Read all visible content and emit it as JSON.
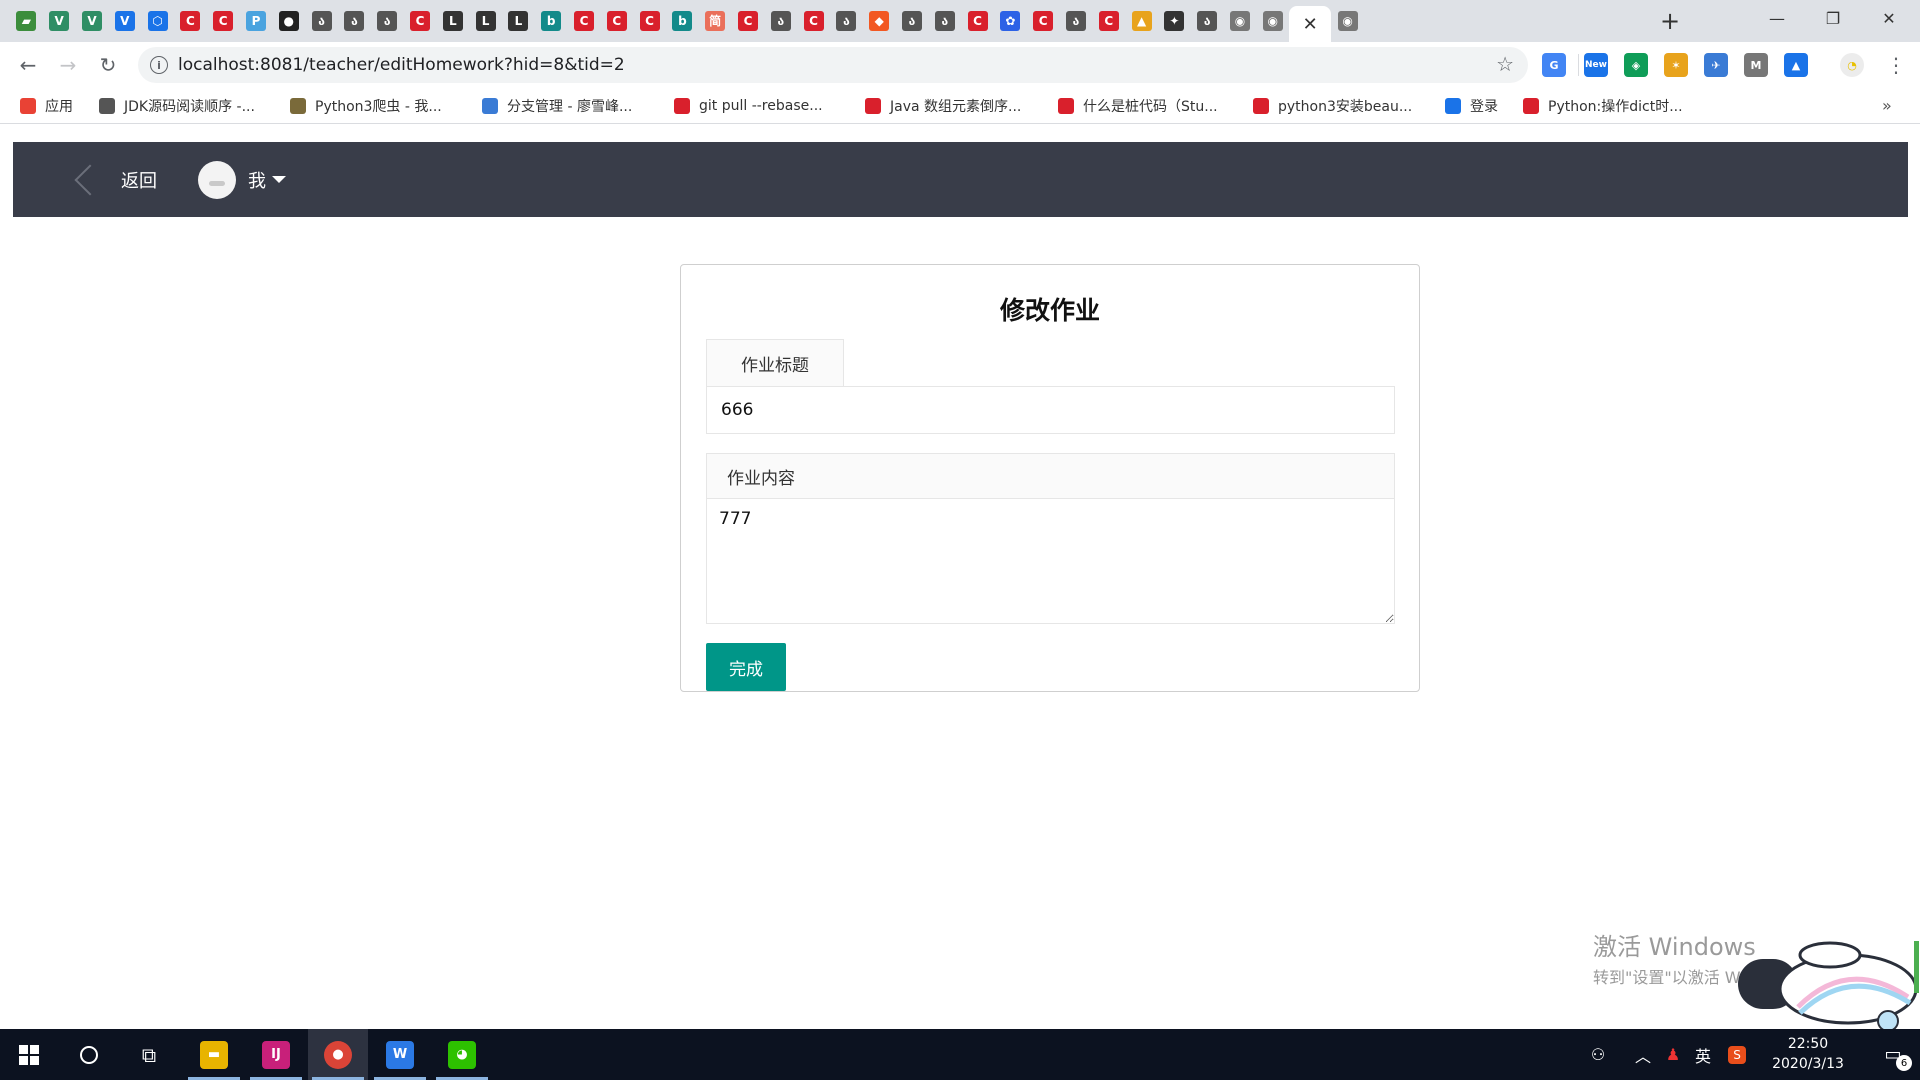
{
  "browser": {
    "tabs": [
      {
        "icon": "map-icon",
        "glyph": "▰",
        "color": "#3c8d3c"
      },
      {
        "icon": "vue-icon",
        "glyph": "V",
        "color": "#2f8e65"
      },
      {
        "icon": "vue-icon",
        "glyph": "V",
        "color": "#2f8e65"
      },
      {
        "icon": "vuetify-icon",
        "glyph": "V",
        "color": "#1a73e8"
      },
      {
        "icon": "hexagon-icon",
        "glyph": "⬡",
        "color": "#1a73e8"
      },
      {
        "icon": "csdn-icon",
        "glyph": "C",
        "color": "#d9202c"
      },
      {
        "icon": "csdn-icon",
        "glyph": "C",
        "color": "#d9202c"
      },
      {
        "icon": "p-circle-icon",
        "glyph": "P",
        "color": "#4aa3df"
      },
      {
        "icon": "github-icon",
        "glyph": "●",
        "color": "#222222"
      },
      {
        "icon": "blog-icon",
        "glyph": "ა",
        "color": "#555555"
      },
      {
        "icon": "blog-icon",
        "glyph": "ა",
        "color": "#555555"
      },
      {
        "icon": "blog-icon",
        "glyph": "ა",
        "color": "#555555"
      },
      {
        "icon": "csdn-icon",
        "glyph": "C",
        "color": "#d9202c"
      },
      {
        "icon": "leetcode-icon",
        "glyph": "L",
        "color": "#333333"
      },
      {
        "icon": "leetcode-icon",
        "glyph": "L",
        "color": "#333333"
      },
      {
        "icon": "leetcode-icon",
        "glyph": "L",
        "color": "#333333"
      },
      {
        "icon": "bing-icon",
        "glyph": "b",
        "color": "#138a8a"
      },
      {
        "icon": "csdn-icon",
        "glyph": "C",
        "color": "#d9202c"
      },
      {
        "icon": "csdn-icon",
        "glyph": "C",
        "color": "#d9202c"
      },
      {
        "icon": "csdn-icon",
        "glyph": "C",
        "color": "#d9202c"
      },
      {
        "icon": "bing-icon",
        "glyph": "b",
        "color": "#138a8a"
      },
      {
        "icon": "jianshu-icon",
        "glyph": "简",
        "color": "#ea6f5a"
      },
      {
        "icon": "csdn-icon",
        "glyph": "C",
        "color": "#d9202c"
      },
      {
        "icon": "blog-icon",
        "glyph": "ა",
        "color": "#555555"
      },
      {
        "icon": "csdn-icon",
        "glyph": "C",
        "color": "#d9202c"
      },
      {
        "icon": "blog-icon",
        "glyph": "ა",
        "color": "#555555"
      },
      {
        "icon": "brave-icon",
        "glyph": "◆",
        "color": "#f25822"
      },
      {
        "icon": "blog-icon",
        "glyph": "ა",
        "color": "#555555"
      },
      {
        "icon": "blog-icon",
        "glyph": "ა",
        "color": "#555555"
      },
      {
        "icon": "csdn-icon",
        "glyph": "C",
        "color": "#d9202c"
      },
      {
        "icon": "baidu-icon",
        "glyph": "✿",
        "color": "#2d62e6"
      },
      {
        "icon": "csdn-icon",
        "glyph": "C",
        "color": "#d9202c"
      },
      {
        "icon": "blog-icon",
        "glyph": "ა",
        "color": "#555555"
      },
      {
        "icon": "csdn-icon",
        "glyph": "C",
        "color": "#d9202c"
      },
      {
        "icon": "pma-icon",
        "glyph": "▲",
        "color": "#e8a31c"
      },
      {
        "icon": "animal-icon",
        "glyph": "✦",
        "color": "#333333"
      },
      {
        "icon": "blog-icon",
        "glyph": "ა",
        "color": "#555555"
      },
      {
        "icon": "globe-icon",
        "glyph": "◉",
        "color": "#777777"
      },
      {
        "icon": "globe-icon",
        "glyph": "◉",
        "color": "#777777"
      },
      {
        "icon": "close-icon",
        "glyph": "✕",
        "color": "#333333",
        "active": true
      },
      {
        "icon": "globe-icon",
        "glyph": "◉",
        "color": "#777777"
      }
    ],
    "url": "localhost:8081/teacher/editHomework?hid=8&tid=2",
    "bookmarks": [
      {
        "icon": "apps-grid-icon",
        "label": "应用",
        "color": "#e94235"
      },
      {
        "icon": "globe-icon",
        "label": "JDK源码阅读顺序 -...",
        "color": "#555555"
      },
      {
        "icon": "python-book-icon",
        "label": "Python3爬虫 - 我...",
        "color": "#7a6a3a"
      },
      {
        "icon": "rocket-icon",
        "label": "分支管理 - 廖雪峰...",
        "color": "#3a7bd5"
      },
      {
        "icon": "csdn-icon",
        "label": "git pull --rebase...",
        "color": "#d9202c"
      },
      {
        "icon": "csdn-icon",
        "label": "Java 数组元素倒序...",
        "color": "#d9202c"
      },
      {
        "icon": "csdn-icon",
        "label": "什么是桩代码（Stu...",
        "color": "#d9202c"
      },
      {
        "icon": "csdn-icon",
        "label": "python3安装beau...",
        "color": "#d9202c"
      },
      {
        "icon": "login-icon",
        "label": "登录",
        "color": "#1a73e8"
      },
      {
        "icon": "csdn-icon",
        "label": "Python:操作dict时...",
        "color": "#d9202c"
      }
    ],
    "extensions": [
      {
        "icon": "translate-icon",
        "glyph": "G",
        "color": "#4285f4"
      },
      {
        "icon": "new-badge-icon",
        "glyph": "New",
        "color": "#1a73e8"
      },
      {
        "icon": "colorful-square-icon",
        "glyph": "◈",
        "color": "#0f9d58"
      },
      {
        "icon": "star-cluster-icon",
        "glyph": "✶",
        "color": "#e8a31c"
      },
      {
        "icon": "bird-icon",
        "glyph": "✈",
        "color": "#3a7bd5"
      },
      {
        "icon": "mail-icon",
        "glyph": "M",
        "color": "#777777"
      },
      {
        "icon": "graduation-icon",
        "glyph": "▲",
        "color": "#1a73e8"
      }
    ]
  },
  "app": {
    "back_label": "返回",
    "user_label": "我",
    "form": {
      "heading": "修改作业",
      "title_label": "作业标题",
      "title_value": "666",
      "content_label": "作业内容",
      "content_value": "777",
      "submit_label": "完成"
    }
  },
  "watermark": {
    "line1": "激活 Windows",
    "line2": "转到\"设置\"以激活 Windows。"
  },
  "taskbar": {
    "time": "22:50",
    "date": "2020/3/13",
    "ime_label": "英",
    "notification_count": "6",
    "apps": [
      {
        "icon": "file-explorer-icon",
        "glyph": "▬",
        "color": "#e8b400",
        "open": true
      },
      {
        "icon": "intellij-icon",
        "glyph": "IJ",
        "color": "#c8207a",
        "open": true
      },
      {
        "icon": "chrome-icon",
        "glyph": "●",
        "color": "#db4437",
        "open": true,
        "active": true
      },
      {
        "icon": "wps-icon",
        "glyph": "W",
        "color": "#2b79e5",
        "open": true
      },
      {
        "icon": "wechat-icon",
        "glyph": "◕",
        "color": "#2dc100",
        "open": true
      }
    ]
  }
}
